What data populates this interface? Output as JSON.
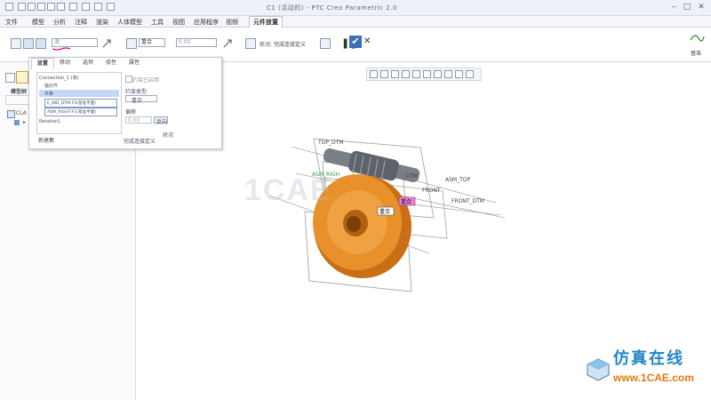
{
  "window": {
    "title": "C1 (活动的) - PTC Creo Parametric 2.0"
  },
  "menubar": {
    "items": [
      "文件",
      "模型",
      "分析",
      "注释",
      "渲染",
      "人体模型",
      "工具",
      "视图",
      "应用程序",
      "视频"
    ],
    "active_tab": "元件放置"
  },
  "ribbon": {
    "constraint_select": "重合",
    "offset_value": "0.00",
    "status_label": "状况:",
    "status_value": "完成连接定义",
    "sub_label": "基准"
  },
  "panel": {
    "tabs": [
      "放置",
      "移动",
      "选项",
      "挠性",
      "属性"
    ],
    "active_tab_index": 0,
    "tree": {
      "connection": "Connection_1 (滑)",
      "axis_align": "轴对齐",
      "translation": "平移",
      "ref1": "E_NID_DTM:F5(基准平面)",
      "ref2": "ASM_RIGHT:F1(基准平面)",
      "rotation": "Rotation1",
      "new_set": "新建集"
    },
    "constraint_enabled": "约束已启用",
    "constraint_type_label": "约束类型",
    "constraint_type": "重合",
    "offset_label": "偏移",
    "offset_value": "0.00",
    "flip_button": "反向",
    "status_label": "状况",
    "status_value": "完成连接定义"
  },
  "sidebar": {
    "tab_label": "模型树",
    "item_root": "CLA",
    "item_child": "▸"
  },
  "canvas": {
    "labels": {
      "top_dtm": "TOP_DTM",
      "asm_top": "ASM_TOP",
      "asm_right": "ASM_RIGH",
      "front": "FRONT",
      "front_dtm": "FRONT_DTM",
      "right_dtm": "_DTM",
      "tag_coincident": "重合",
      "tag_coincident2": "重合"
    }
  },
  "watermark": {
    "text": "1CAE",
    "brand_cn": "仿真在线",
    "brand_url": "www.1CAE.com"
  },
  "colors": {
    "gear": "#e8902a",
    "worm": "#7a7f86",
    "accent": "#3d6fb4",
    "brand_cn": "#1e86c8"
  }
}
